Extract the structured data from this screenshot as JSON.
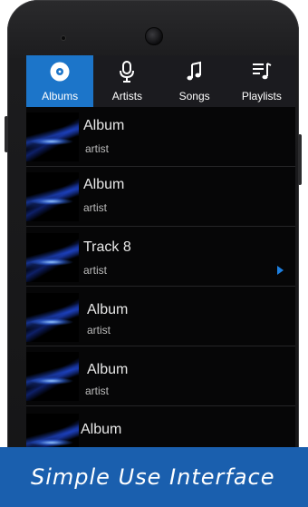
{
  "tabs": [
    {
      "label": "Albums",
      "icon": "album-disc-icon",
      "active": true
    },
    {
      "label": "Artists",
      "icon": "microphone-icon",
      "active": false
    },
    {
      "label": "Songs",
      "icon": "music-note-icon",
      "active": false
    },
    {
      "label": "Playlists",
      "icon": "playlist-icon",
      "active": false
    }
  ],
  "items": [
    {
      "title": "Album",
      "subtitle": "artist",
      "playing": false
    },
    {
      "title": "Album",
      "subtitle": "artist",
      "playing": false
    },
    {
      "title": "Track 8",
      "subtitle": "artist",
      "playing": true
    },
    {
      "title": "Album",
      "subtitle": "artist",
      "playing": false
    },
    {
      "title": "Album",
      "subtitle": "artist",
      "playing": false
    },
    {
      "title": "Album",
      "subtitle": "",
      "playing": false
    }
  ],
  "banner": {
    "text": "Simple Use Interface"
  },
  "colors": {
    "accent": "#1c75c9",
    "banner": "#1a5fae",
    "background": "#060607"
  }
}
